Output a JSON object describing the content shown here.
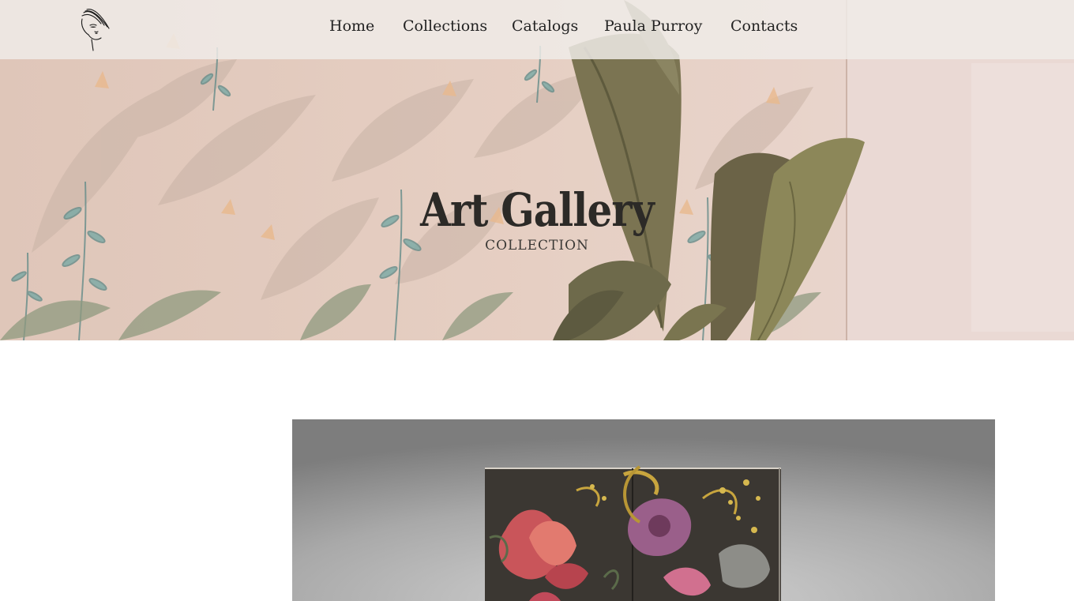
{
  "site": {
    "logo_icon": "woman-face-logo-icon"
  },
  "nav": {
    "items": [
      {
        "label": "Home"
      },
      {
        "label": "Collections"
      },
      {
        "label": "Catalogs"
      },
      {
        "label": "Paula Purroy"
      },
      {
        "label": "Contacts"
      }
    ]
  },
  "hero": {
    "title": "Art Gallery",
    "subtitle": "COLLECTION",
    "background": "botanical-wallpaper-image"
  },
  "content": {
    "image": "floral-folding-screen-artwork"
  },
  "colors": {
    "hero_bg": "#e4cbbf",
    "nav_bg": "#f0ece8",
    "title_text": "#2c2a27",
    "nav_text": "#222222"
  }
}
